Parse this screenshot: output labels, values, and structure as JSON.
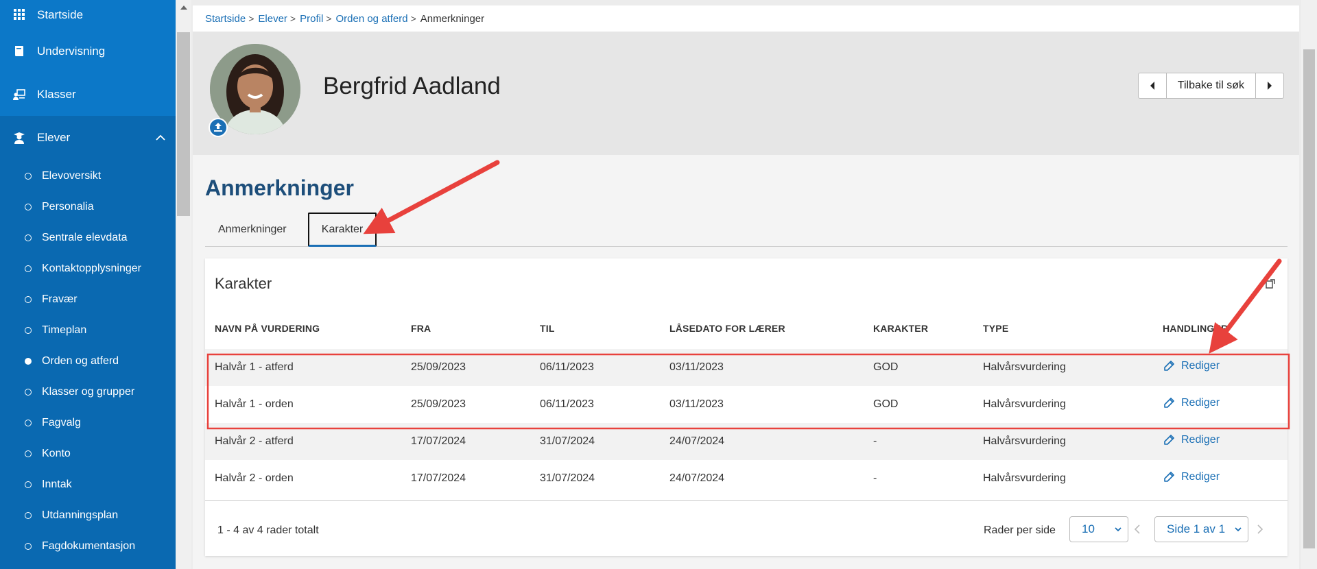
{
  "sidebar": {
    "top_items": [
      {
        "label": "Startside",
        "icon": "grid-icon"
      },
      {
        "label": "Undervisning",
        "icon": "book-icon"
      },
      {
        "label": "Klasser",
        "icon": "classroom-icon"
      },
      {
        "label": "Elever",
        "icon": "student-icon"
      }
    ],
    "sub_items": [
      "Elevoversikt",
      "Personalia",
      "Sentrale elevdata",
      "Kontaktopplysninger",
      "Fravær",
      "Timeplan",
      "Orden og atferd",
      "Klasser og grupper",
      "Fagvalg",
      "Konto",
      "Inntak",
      "Utdanningsplan",
      "Fagdokumentasjon"
    ],
    "active_sub": "Orden og atferd"
  },
  "breadcrumb": [
    "Startside",
    "Elever",
    "Profil",
    "Orden og atferd",
    "Anmerkninger"
  ],
  "profile": {
    "name": "Bergfrid Aadland",
    "back_button": "Tilbake til søk"
  },
  "page": {
    "title": "Anmerkninger",
    "tabs": [
      "Anmerkninger",
      "Karakter"
    ],
    "active_tab": "Karakter"
  },
  "card": {
    "title": "Karakter",
    "columns": [
      "NAVN PÅ VURDERING",
      "FRA",
      "TIL",
      "LÅSEDATO FOR LÆRER",
      "KARAKTER",
      "TYPE",
      "HANDLINGER"
    ],
    "rows": [
      {
        "name": "Halvår 1 - atferd",
        "from": "25/09/2023",
        "to": "06/11/2023",
        "lock": "03/11/2023",
        "grade": "GOD",
        "type": "Halvårsvurdering",
        "action": "Rediger"
      },
      {
        "name": "Halvår 1 - orden",
        "from": "25/09/2023",
        "to": "06/11/2023",
        "lock": "03/11/2023",
        "grade": "GOD",
        "type": "Halvårsvurdering",
        "action": "Rediger"
      },
      {
        "name": "Halvår 2 - atferd",
        "from": "17/07/2024",
        "to": "31/07/2024",
        "lock": "24/07/2024",
        "grade": "-",
        "type": "Halvårsvurdering",
        "action": "Rediger"
      },
      {
        "name": "Halvår 2 - orden",
        "from": "17/07/2024",
        "to": "31/07/2024",
        "lock": "24/07/2024",
        "grade": "-",
        "type": "Halvårsvurdering",
        "action": "Rediger"
      }
    ],
    "footer": {
      "count": "1 - 4 av 4 rader totalt",
      "rows_per_page_label": "Rader per side",
      "rows_per_page": "10",
      "page": "Side 1 av 1"
    }
  },
  "colors": {
    "sidebar": "#0a69b1",
    "link": "#1a6fb5",
    "annotation": "#e8413c"
  }
}
